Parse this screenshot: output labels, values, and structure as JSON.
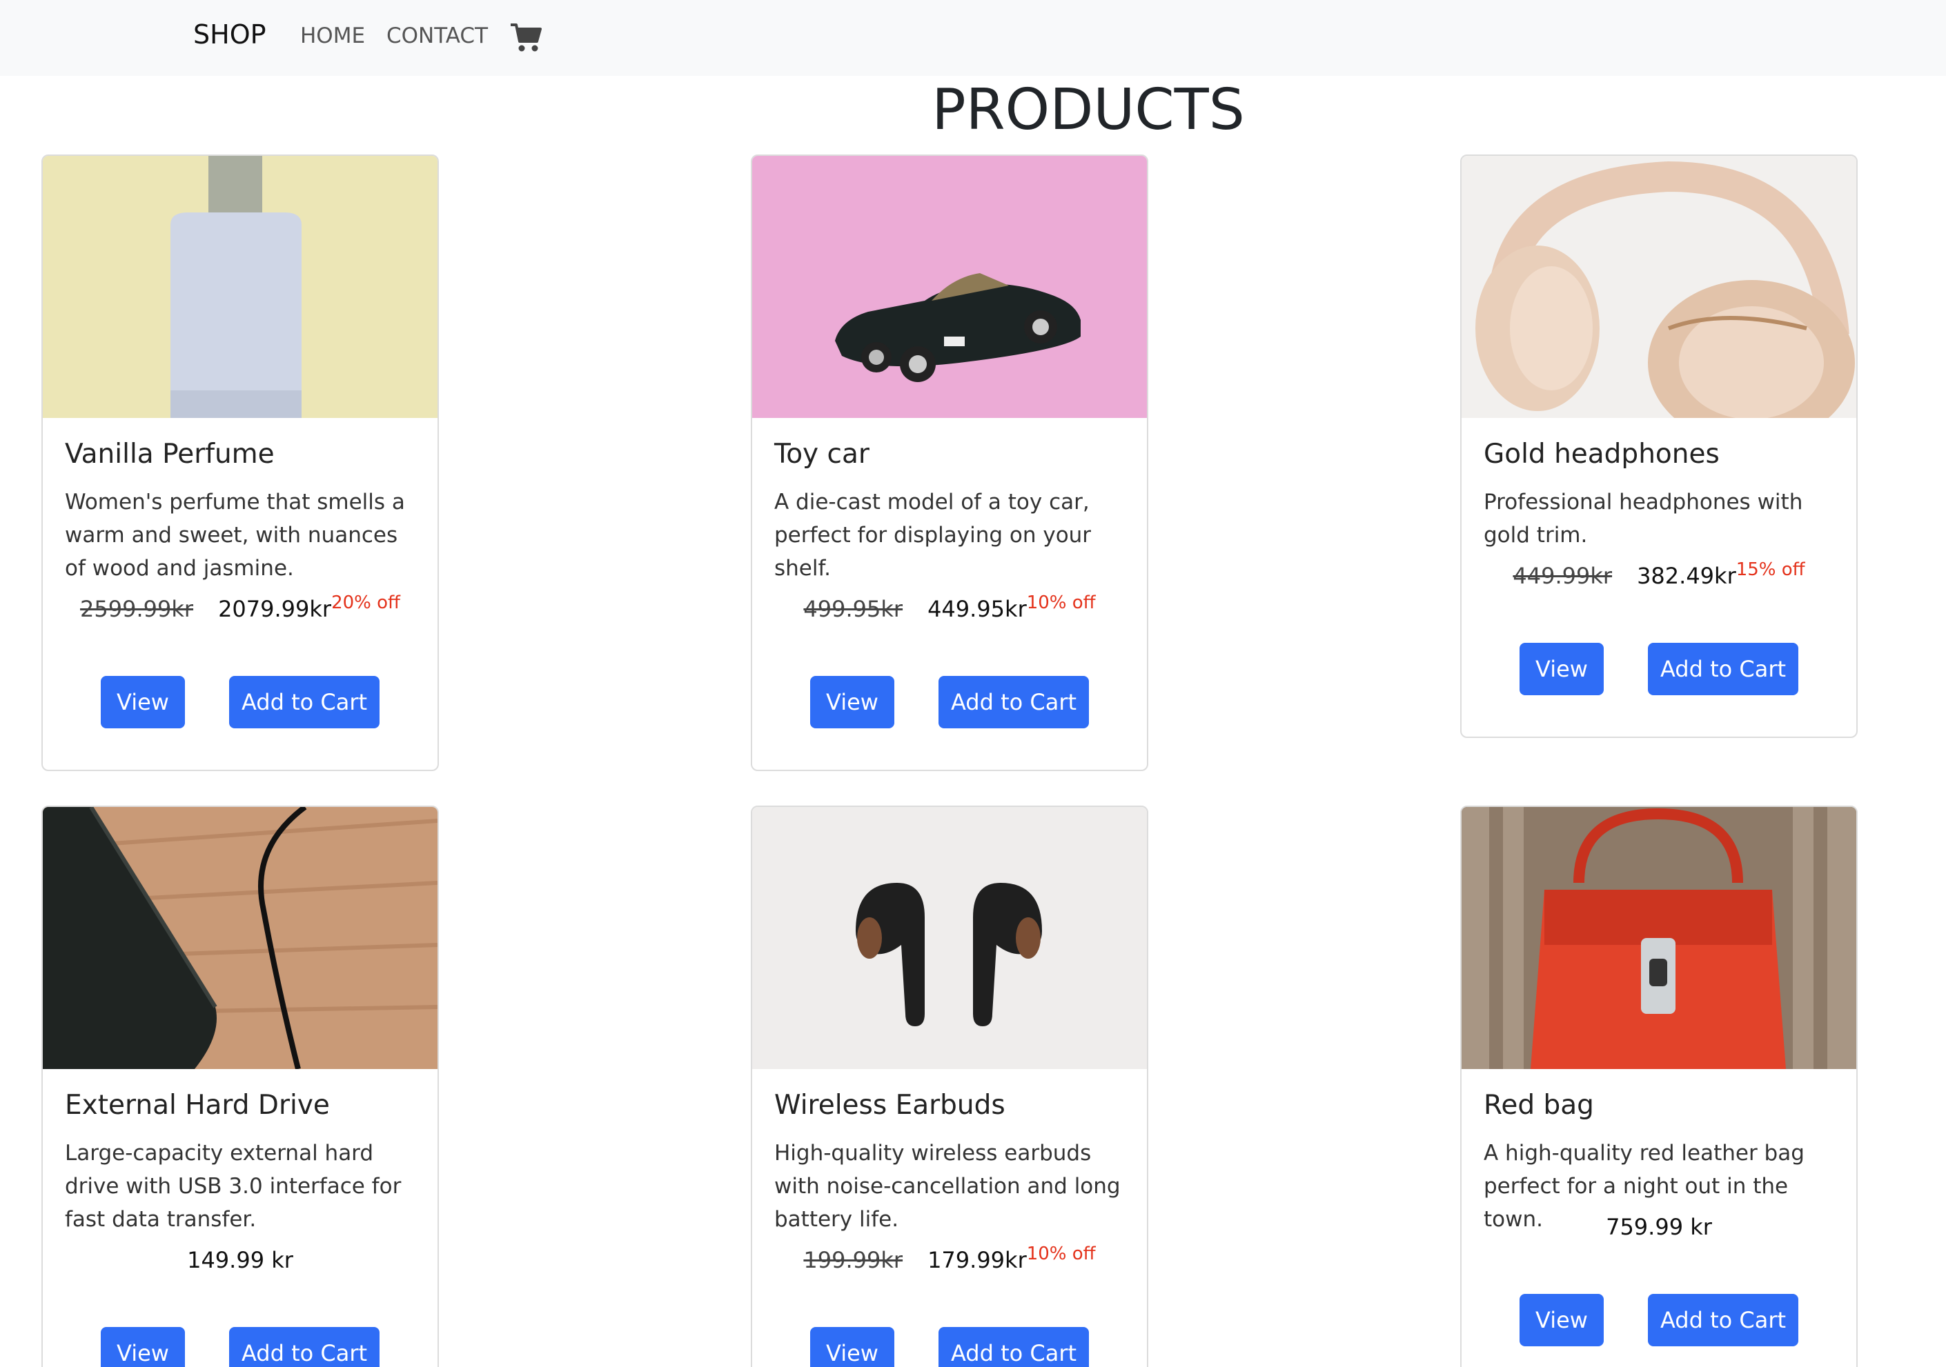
{
  "nav": {
    "brand": "SHOP",
    "home": "HOME",
    "contact": "CONTACT"
  },
  "page": {
    "title": "PRODUCTS"
  },
  "products": [
    {
      "name": "Vanilla Perfume",
      "description": "Women's perfume that smells a warm and sweet, with nuances of wood and jasmine.",
      "old_price": "2599.99kr",
      "price": "2079.99kr",
      "discount": "20% off",
      "view_label": "View",
      "cart_label": "Add to Cart"
    },
    {
      "name": "Toy car",
      "description": "A die-cast model of a toy car, perfect for displaying on your shelf.",
      "old_price": "499.95kr",
      "price": "449.95kr",
      "discount": "10% off",
      "view_label": "View",
      "cart_label": "Add to Cart"
    },
    {
      "name": "Gold headphones",
      "description": "Professional headphones with gold trim.",
      "old_price": "449.99kr",
      "price": "382.49kr",
      "discount": "15% off",
      "view_label": "View",
      "cart_label": "Add to Cart"
    },
    {
      "name": "External Hard Drive",
      "description": "Large-capacity external hard drive with USB 3.0 interface for fast data transfer.",
      "price": "149.99 kr",
      "view_label": "View",
      "cart_label": "Add to Cart"
    },
    {
      "name": "Wireless Earbuds",
      "description": "High-quality wireless earbuds with noise-cancellation and long battery life.",
      "old_price": "199.99kr",
      "price": "179.99kr",
      "discount": "10% off",
      "view_label": "View",
      "cart_label": "Add to Cart"
    },
    {
      "name": "Red bag",
      "description": "A high-quality red leather bag perfect for a night out in the town.",
      "price": "759.99 kr",
      "view_label": "View",
      "cart_label": "Add to Cart"
    }
  ],
  "colors": {
    "button": "#2f6df6",
    "discount": "#e4321b",
    "navbar": "#f8f9fa"
  }
}
